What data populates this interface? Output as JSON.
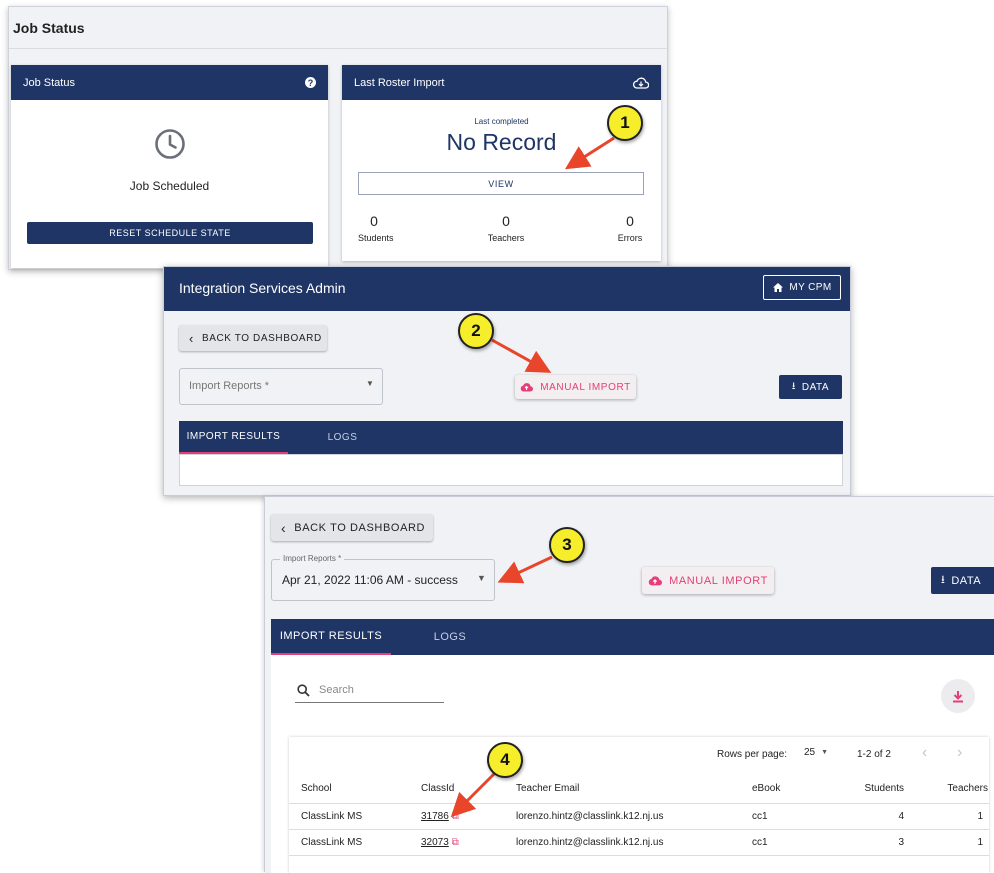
{
  "panel1": {
    "header_title": "Job Status",
    "job_card": {
      "title": "Job Status",
      "status_text": "Job Scheduled",
      "reset_button": "RESET SCHEDULE STATE"
    },
    "roster_card": {
      "title": "Last Roster Import",
      "last_completed_label": "Last completed",
      "record_text": "No Record",
      "view_button": "VIEW",
      "stats": [
        {
          "value": "0",
          "label": "Students"
        },
        {
          "value": "0",
          "label": "Teachers"
        },
        {
          "value": "0",
          "label": "Errors"
        }
      ]
    }
  },
  "panel2": {
    "app_title": "Integration Services Admin",
    "my_cpm_button": "MY CPM",
    "back_button": "BACK TO DASHBOARD",
    "select_placeholder": "Import Reports *",
    "manual_import_button": "MANUAL IMPORT",
    "data_button": "DATA",
    "tabs": [
      "IMPORT RESULTS",
      "LOGS"
    ]
  },
  "panel3": {
    "back_button": "BACK TO DASHBOARD",
    "select_label": "Import Reports *",
    "select_value": "Apr 21, 2022 11:06 AM - success",
    "manual_import_button": "MANUAL IMPORT",
    "data_button": "DATA",
    "tabs": [
      "IMPORT RESULTS",
      "LOGS"
    ],
    "search_placeholder": "Search",
    "pagination": {
      "rows_per_page_label": "Rows per page:",
      "rows_per_page_value": "25",
      "range": "1-2 of 2"
    },
    "table": {
      "columns": [
        "School",
        "ClassId",
        "Teacher Email",
        "eBook",
        "Students",
        "Teachers"
      ],
      "rows": [
        [
          "ClassLink MS",
          "31786",
          "lorenzo.hintz@classlink.k12.nj.us",
          "cc1",
          "4",
          "1"
        ],
        [
          "ClassLink MS",
          "32073",
          "lorenzo.hintz@classlink.k12.nj.us",
          "cc1",
          "3",
          "1"
        ]
      ]
    }
  },
  "callouts": [
    "1",
    "2",
    "3",
    "4"
  ],
  "colors": {
    "navy": "#1f3566",
    "accent_pink": "#e43f7a",
    "callout_yellow": "#f6ee2b",
    "arrow_red": "#e8452a"
  },
  "icons": [
    "help-icon",
    "cloud-download-icon",
    "clock-icon",
    "home-icon",
    "chevron-left-icon",
    "dropdown-arrow-icon",
    "cloud-upload-icon",
    "download-icon",
    "search-icon",
    "external-link-icon"
  ]
}
